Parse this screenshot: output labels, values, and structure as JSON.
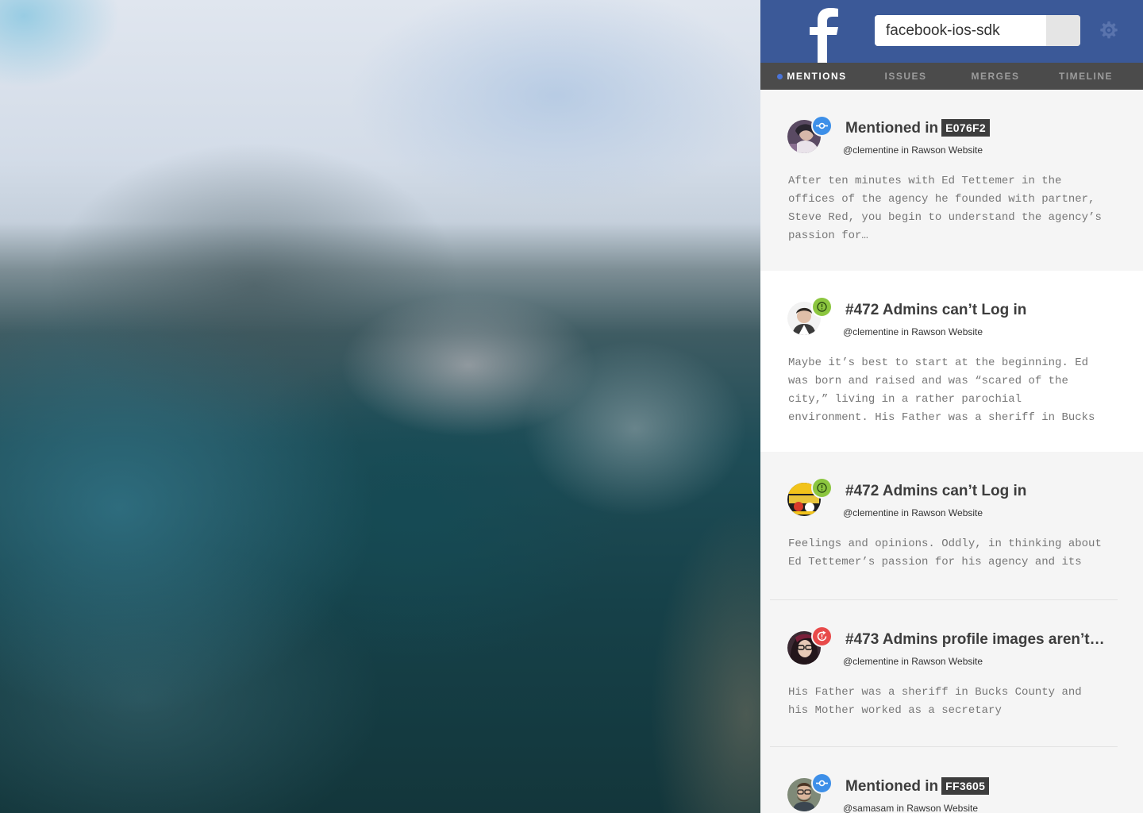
{
  "app": {
    "logo_icon": "facebook-f-icon",
    "brand_color": "#3b5998",
    "search": {
      "value": "facebook-ios-sdk",
      "placeholder": ""
    },
    "settings_icon": "gear-icon"
  },
  "tabs": [
    {
      "label": "MENTIONS",
      "active": true
    },
    {
      "label": "ISSUES",
      "active": false
    },
    {
      "label": "MERGES",
      "active": false
    },
    {
      "label": "TIMELINE",
      "active": false
    }
  ],
  "feed": [
    {
      "type": "mention",
      "badge_icon": "commit-icon",
      "badge_color": "#3d8fe8",
      "title": "Mentioned in",
      "hash": "E076F2",
      "meta": "@clementine in Rawson Website",
      "excerpt": "After ten minutes with Ed Tettemer in the\noffices of the agency he founded with partner,\nSteve Red, you begin to understand the agency’s\npassion for…"
    },
    {
      "type": "issue",
      "badge_icon": "issue-open-icon",
      "badge_color": "#8cc63f",
      "title": "#472 Admins can’t Log in",
      "hash": "",
      "meta": "@clementine in Rawson Website",
      "excerpt": "Maybe it’s best to start at the beginning. Ed\nwas born and raised and was “scared of the\ncity,” living in a rather parochial\nenvironment. His Father was a sheriff in Bucks"
    },
    {
      "type": "issue",
      "badge_icon": "issue-open-icon",
      "badge_color": "#8cc63f",
      "title": "#472 Admins can’t Log in",
      "hash": "",
      "meta": "@clementine in Rawson Website",
      "excerpt": "Feelings and opinions. Oddly, in thinking about\nEd Tettemer’s passion for his agency and its"
    },
    {
      "type": "issue-reopened",
      "badge_icon": "issue-reopened-icon",
      "badge_color": "#e84a4a",
      "title": "#473 Admins profile images aren’t…",
      "hash": "",
      "meta": "@clementine in Rawson Website",
      "excerpt": "His Father was a sheriff in Bucks County and\nhis Mother worked as a secretary"
    },
    {
      "type": "mention",
      "badge_icon": "commit-icon",
      "badge_color": "#3d8fe8",
      "title": "Mentioned in",
      "hash": "FF3605",
      "meta": "@samasam in Rawson Website",
      "excerpt": ""
    }
  ]
}
